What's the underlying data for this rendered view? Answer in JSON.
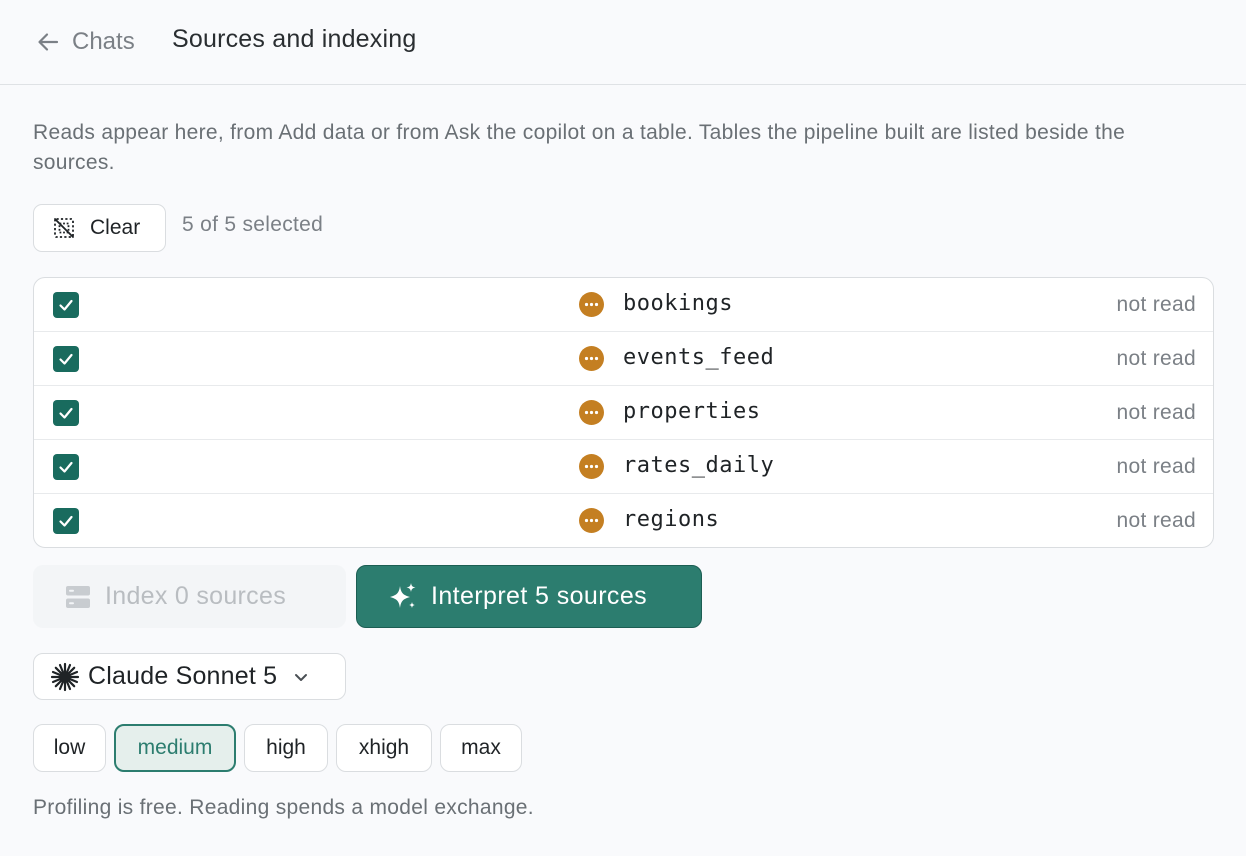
{
  "header": {
    "back_label": "Chats",
    "title": "Sources and indexing"
  },
  "description": "Reads appear here, from Add data or from Ask the copilot on a table. Tables the pipeline built are listed beside the sources.",
  "toolbar": {
    "clear_label": "Clear",
    "selection_count": "5 of 5 selected"
  },
  "sources": [
    {
      "name": "bookings",
      "status": "not read",
      "checked": true
    },
    {
      "name": "events_feed",
      "status": "not read",
      "checked": true
    },
    {
      "name": "properties",
      "status": "not read",
      "checked": true
    },
    {
      "name": "rates_daily",
      "status": "not read",
      "checked": true
    },
    {
      "name": "regions",
      "status": "not read",
      "checked": true
    }
  ],
  "actions": {
    "index_label": "Index 0 sources",
    "index_enabled": false,
    "interpret_label": "Interpret 5 sources"
  },
  "model": {
    "selected": "Claude Sonnet 5"
  },
  "effort": {
    "options": [
      "low",
      "medium",
      "high",
      "xhigh",
      "max"
    ],
    "selected": "medium"
  },
  "footnote": "Profiling is free. Reading spends a model exchange.",
  "colors": {
    "accent": "#2c7d6f",
    "checkbox": "#196b5e",
    "status_dot": "#c47f22",
    "muted_text": "#7b8086",
    "background": "#f9fafc"
  },
  "icons": {
    "back": "arrow-left-icon",
    "clear": "deselect-icon",
    "status": "pending-dots-icon",
    "index": "server-icon",
    "interpret": "sparkles-icon",
    "model": "claude-star-icon",
    "dropdown": "chevron-down-icon"
  }
}
